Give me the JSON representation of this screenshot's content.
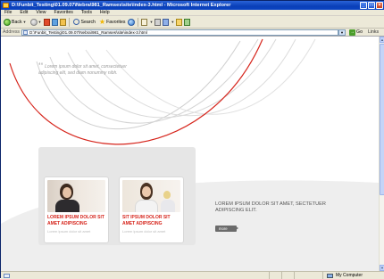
{
  "window": {
    "title": "D:\\Funbit_Testing\\01.09.07\\Nebra\\981_Ramses\\site\\index-3.html - Microsoft Internet Explorer",
    "buttons": {
      "minimize": "_",
      "maximize": "□",
      "close": "×"
    }
  },
  "menu": [
    "File",
    "Edit",
    "View",
    "Favorites",
    "Tools",
    "Help"
  ],
  "toolbar": {
    "back": "Back",
    "search": "Search",
    "favorites": "Favorites"
  },
  "address": {
    "label": "Address",
    "value": "D:\\Funbit_Testing\\01.09.07\\Nebra\\981_Ramses\\site\\index-3.html",
    "go": "Go",
    "links": "Links"
  },
  "page": {
    "quote": "Lorem ipsum dolor sit amet, consectetuer adipiscing elit, sed diam nonummy nibh.",
    "cards": [
      {
        "title": "LOREM IPSUM DOLOR SIT AMET ADIPISCING",
        "sub": "Lorem ipsum dolor sit amet"
      },
      {
        "title": "SIT IPSUM DOLOR SIT AMET ADIPISCING",
        "sub": "Lorem ipsum dolor sit amet"
      }
    ],
    "hero_text": "LOREM IPSUM DOLOR SIT AMET, SECTETUER ADIPISCING ELIT.",
    "more_label": "more"
  },
  "status": {
    "zone": "My Computer"
  },
  "colors": {
    "accent_red": "#d6241b",
    "titlebar_blue": "#0a3fb8"
  }
}
